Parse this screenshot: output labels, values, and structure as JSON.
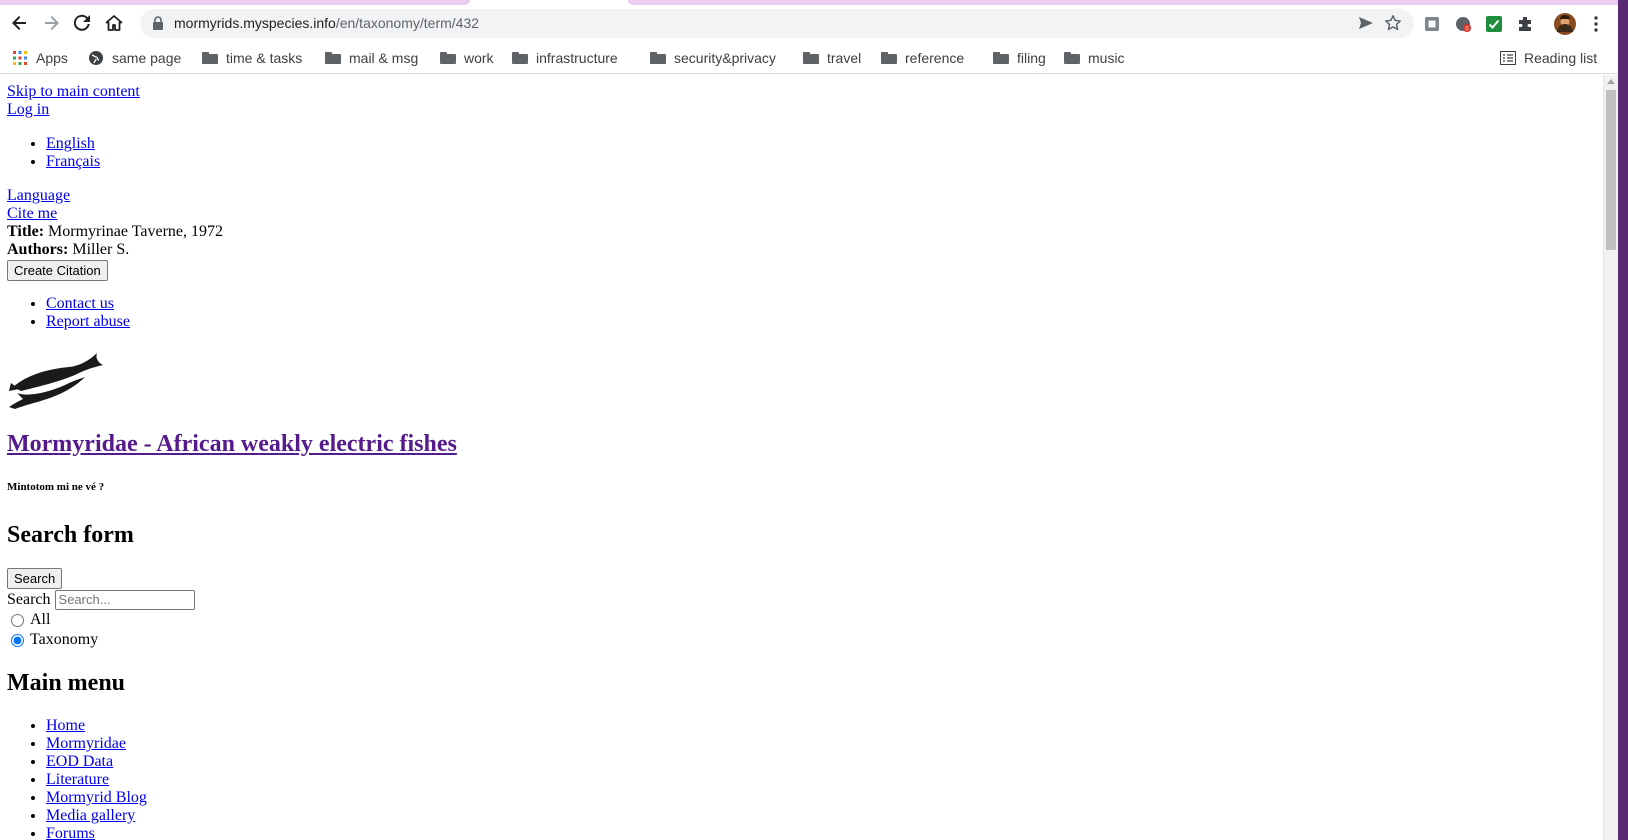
{
  "browser": {
    "url_host": "mormyrids.myspecies.info",
    "url_path": "/en/taxonomy/term/432",
    "bookmarks": [
      {
        "label": "Apps",
        "icon": "apps-grid-icon"
      },
      {
        "label": "same page",
        "icon": "globe-icon"
      },
      {
        "label": "time & tasks",
        "icon": "folder-icon"
      },
      {
        "label": "mail & msg",
        "icon": "folder-icon"
      },
      {
        "label": "work",
        "icon": "folder-icon"
      },
      {
        "label": "infrastructure",
        "icon": "folder-icon"
      },
      {
        "label": "security&privacy",
        "icon": "folder-icon"
      },
      {
        "label": "travel",
        "icon": "folder-icon"
      },
      {
        "label": "reference",
        "icon": "folder-icon"
      },
      {
        "label": "filing",
        "icon": "folder-icon"
      },
      {
        "label": "music",
        "icon": "folder-icon"
      }
    ],
    "reading_list": "Reading list"
  },
  "page": {
    "skip_link": "Skip to main content",
    "login_link": "Log in",
    "languages": [
      "English",
      "Français"
    ],
    "language_link": "Language",
    "cite_link": "Cite me",
    "citation": {
      "title_label": "Title:",
      "title_value": "Mormyrinae Taverne, 1972",
      "authors_label": "Authors:",
      "authors_value": "Miller S.",
      "create_button": "Create Citation"
    },
    "footer_links": [
      "Contact us",
      "Report abuse"
    ],
    "site_name": "Mormyridae - African weakly electric fishes",
    "slogan": "Mintotom mi ne vé ?",
    "search": {
      "heading": "Search form",
      "button": "Search",
      "label": "Search",
      "placeholder": "Search...",
      "options": [
        {
          "label": "All",
          "checked": false
        },
        {
          "label": "Taxonomy",
          "checked": true
        }
      ]
    },
    "main_menu": {
      "heading": "Main menu",
      "items": [
        "Home",
        "Mormyridae",
        "EOD Data",
        "Literature",
        "Mormyrid Blog",
        "Media gallery",
        "Forums"
      ]
    }
  }
}
